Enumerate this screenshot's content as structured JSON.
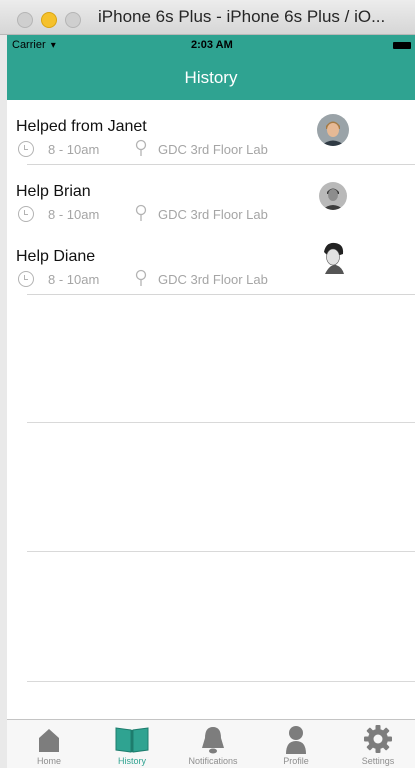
{
  "window": {
    "title": "iPhone 6s Plus - iPhone 6s Plus / iO..."
  },
  "status_bar": {
    "carrier": "Carrier",
    "time": "2:03 AM"
  },
  "nav": {
    "title": "History"
  },
  "history": [
    {
      "title": "Helped from Janet",
      "time_range": "8 - 10am",
      "location": "GDC 3rd Floor Lab"
    },
    {
      "title": "Help Brian",
      "time_range": "8 - 10am",
      "location": "GDC 3rd Floor Lab"
    },
    {
      "title": "Help Diane",
      "time_range": "8 - 10am",
      "location": "GDC 3rd Floor Lab"
    }
  ],
  "tabs": [
    {
      "label": "Home",
      "icon": "home-icon",
      "active": false
    },
    {
      "label": "History",
      "icon": "book-icon",
      "active": true
    },
    {
      "label": "Notifications",
      "icon": "bell-icon",
      "active": false
    },
    {
      "label": "Profile",
      "icon": "person-icon",
      "active": false
    },
    {
      "label": "Settings",
      "icon": "gear-icon",
      "active": false
    }
  ],
  "colors": {
    "accent": "#2fa391",
    "icon_gray": "#7d7d7d"
  }
}
